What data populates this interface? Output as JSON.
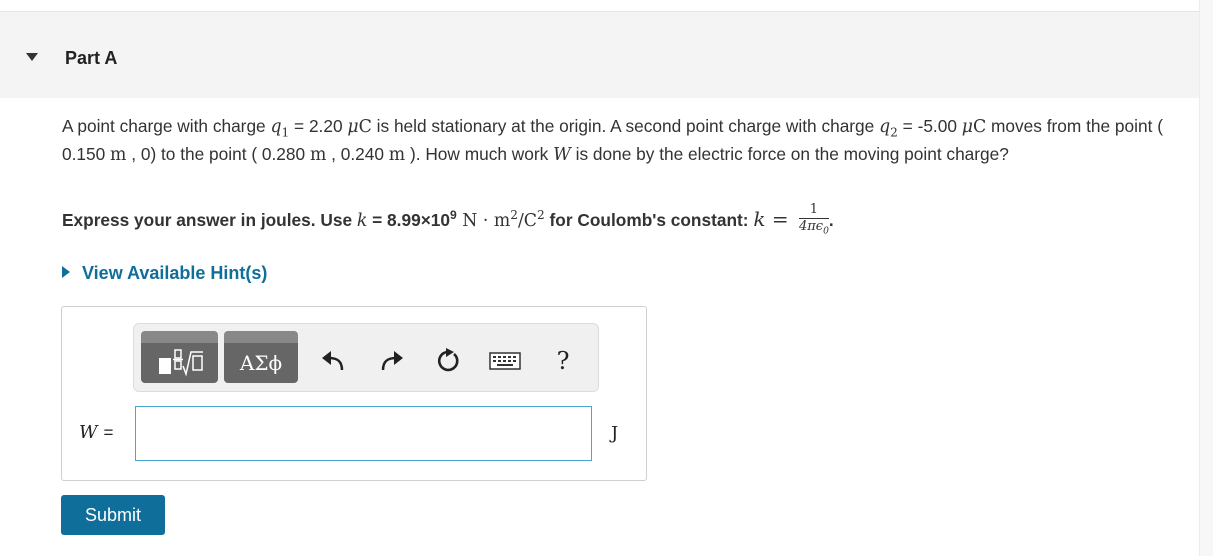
{
  "part": {
    "title": "Part A"
  },
  "problem": {
    "s1": "A point charge with charge ",
    "q1_sym": "q",
    "q1_sub": "1",
    "s2": " = 2.20 ",
    "micro": "μ",
    "coulomb": "C",
    "s3": " is held stationary at the origin. A second point charge with charge ",
    "q2_sym": "q",
    "q2_sub": "2",
    "s4": " = -5.00 ",
    "s5": " moves from the point ( 0.150 ",
    "m": "m",
    "s6": " , 0) to the point ( 0.280 ",
    "s7": " , 0.240 ",
    "s8": " ). How much work ",
    "w_sym": "W",
    "s9": " is done by the electric force on the moving point charge?"
  },
  "instruction": {
    "s1": "Express your answer in joules. Use ",
    "k": "k",
    "s2": " = 8.99×10",
    "exp": "9",
    "units": " N · m",
    "units_exp": "2",
    "units_c": "/C",
    "units_c_exp": "2",
    "s3": " for Coulomb's constant: ",
    "k2": "k",
    "eq": " = ",
    "frac_num": "1",
    "frac_den": "4πϵ",
    "frac_den_sub": "0",
    "end": "."
  },
  "hint": {
    "label": "View Available Hint(s)"
  },
  "toolbar": {
    "greek_label": "ΑΣϕ",
    "help_label": "?"
  },
  "answer": {
    "var": "W",
    "equals": "=",
    "value": "",
    "unit": "J"
  },
  "submit": {
    "label": "Submit"
  },
  "colors": {
    "link": "#0f6e9a",
    "submit_bg": "#0f6e9a",
    "input_border": "#4aa6d4"
  }
}
